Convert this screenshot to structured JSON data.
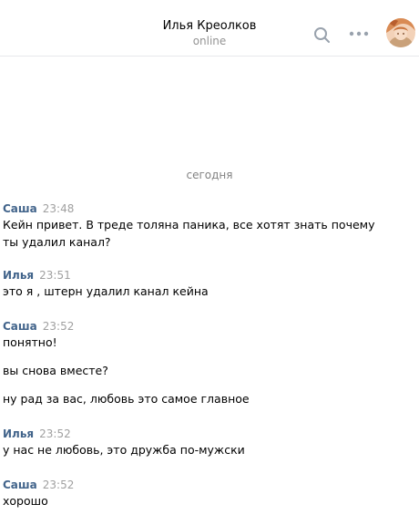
{
  "header": {
    "name": "Илья Креолков",
    "status": "online",
    "search_icon": "search-icon",
    "more_icon": "more-horizontal-icon"
  },
  "date_divider": "сегодня",
  "messages": [
    {
      "author": "Саша",
      "time": "23:48",
      "texts": [
        "Кейн привет. В треде толяна паника, все хотят знать почему\nты удалил канал?"
      ]
    },
    {
      "author": "Илья",
      "time": "23:51",
      "texts": [
        "это я , штерн удалил канал кейна"
      ]
    },
    {
      "author": "Саша",
      "time": "23:52",
      "texts": [
        "понятно!",
        "вы снова вместе?",
        "ну рад за вас, любовь это самое главное"
      ]
    },
    {
      "author": "Илья",
      "time": "23:52",
      "texts": [
        "у нас не любовь, это дружба по-мужски"
      ]
    },
    {
      "author": "Саша",
      "time": "23:52",
      "texts": [
        "хорошо"
      ]
    }
  ],
  "colors": {
    "author": "#42648b",
    "time": "#a0a0a0",
    "status": "#939393"
  }
}
